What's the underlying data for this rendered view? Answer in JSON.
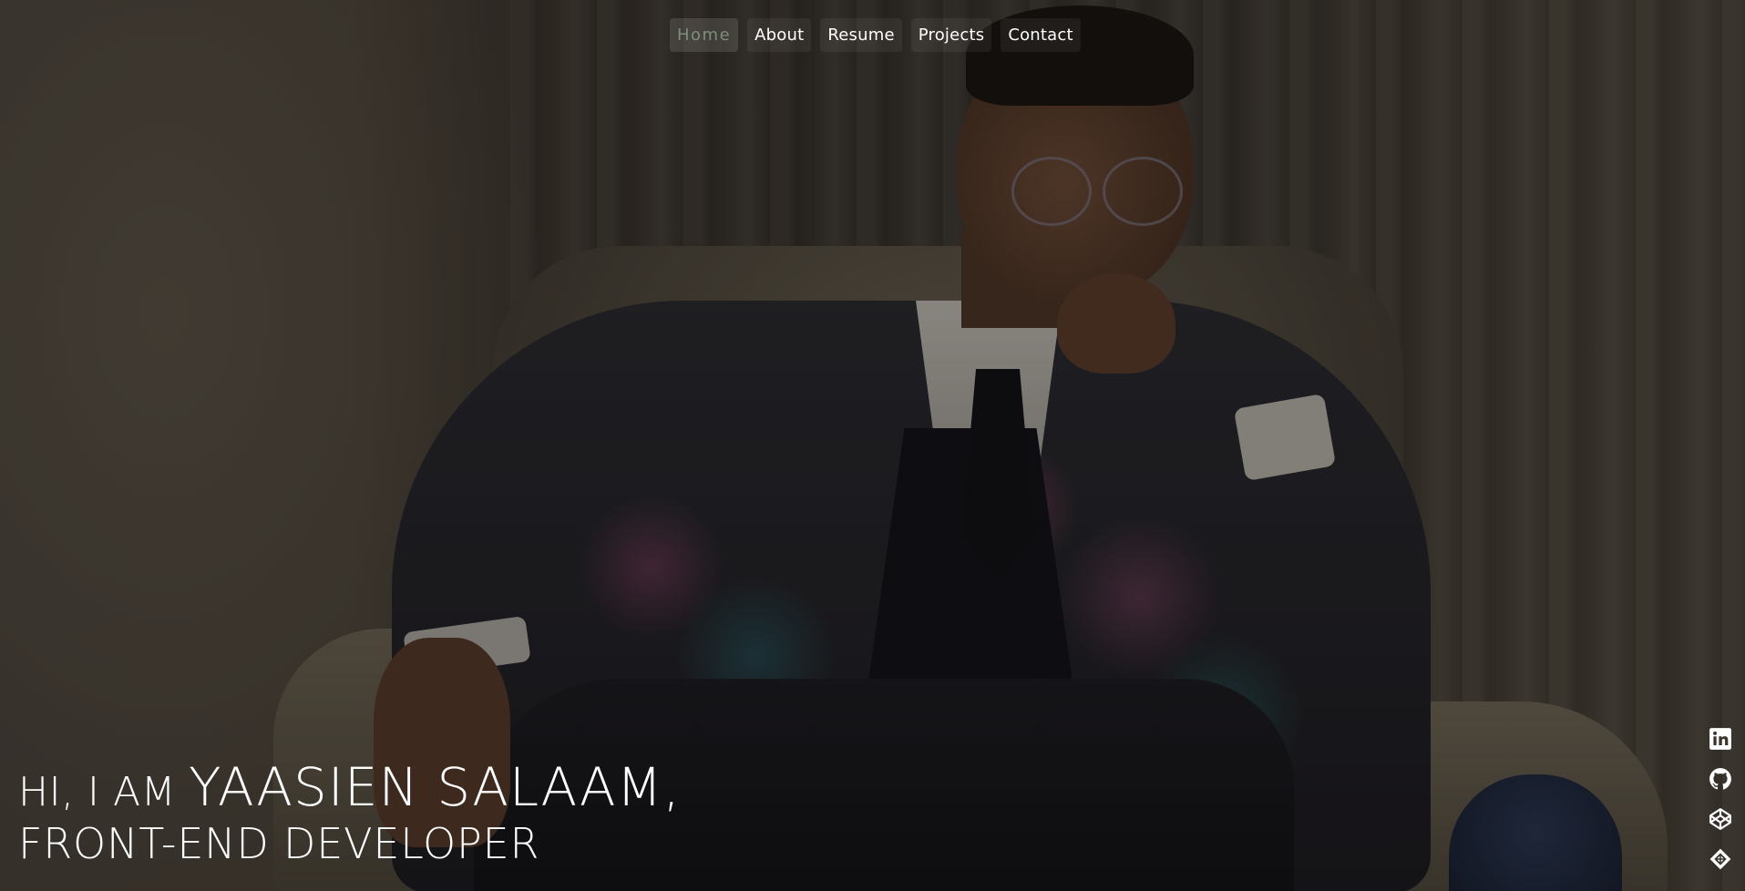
{
  "nav": {
    "items": [
      {
        "label": "Home",
        "active": true
      },
      {
        "label": "About",
        "active": false
      },
      {
        "label": "Resume",
        "active": false
      },
      {
        "label": "Projects",
        "active": false
      },
      {
        "label": "Contact",
        "active": false
      }
    ]
  },
  "hero": {
    "intro": "HI, I AM",
    "name": "YAASIEN SALAAM,",
    "role": "FRONT-END DEVELOPER"
  },
  "social": {
    "icons": [
      "linkedin-icon",
      "github-icon",
      "codepen-icon",
      "codesandbox-icon"
    ]
  },
  "colors": {
    "nav_active": "#7c8f7c",
    "text": "#ffffff"
  }
}
